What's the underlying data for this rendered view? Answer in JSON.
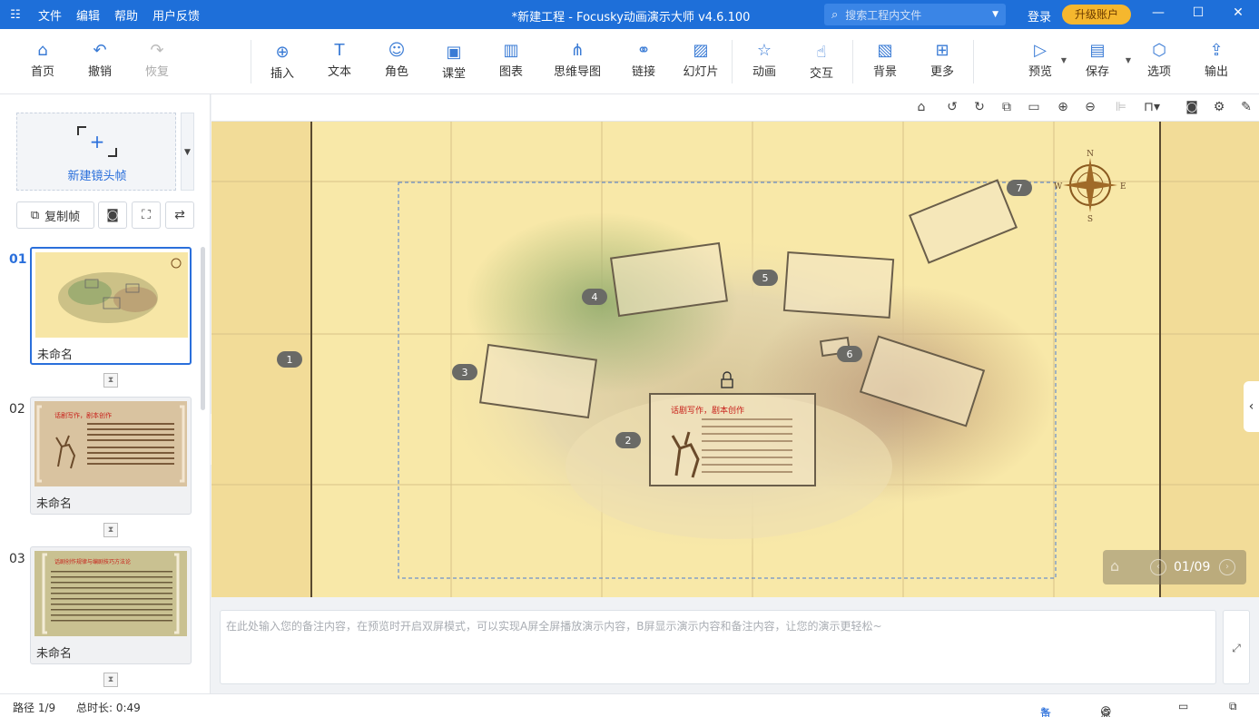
{
  "titlebar": {
    "logo": "☷",
    "menu": [
      "文件",
      "编辑",
      "帮助",
      "用户反馈"
    ],
    "title": "*新建工程 - Focusky动画演示大师  v4.6.100",
    "search_placeholder": "搜索工程内文件",
    "login": "登录",
    "upgrade": "升级账户",
    "accent": "#1e6fd9"
  },
  "toolbar": {
    "home": "首页",
    "undo": "撤销",
    "redo": "恢复",
    "insert": "插入",
    "text": "文本",
    "role": "角色",
    "classroom": "课堂",
    "chart": "图表",
    "mindmap": "思维导图",
    "link": "链接",
    "slide": "幻灯片",
    "animation": "动画",
    "interact": "交互",
    "background": "背景",
    "more": "更多",
    "preview": "预览",
    "save": "保存",
    "options": "选项",
    "export": "输出"
  },
  "left": {
    "new_frame": "新建镜头帧",
    "copy_frame": "复制帧",
    "frames": [
      {
        "num": "01",
        "name": "未命名"
      },
      {
        "num": "02",
        "name": "未命名"
      },
      {
        "num": "03",
        "name": "未命名"
      }
    ]
  },
  "canvas": {
    "markers": [
      "1",
      "2",
      "3",
      "4",
      "5",
      "6",
      "7"
    ],
    "compass": {
      "n": "N",
      "s": "S",
      "e": "E",
      "w": "W"
    },
    "slide_title_2": "话剧写作，剧本创作",
    "slide_title_3": "话剧创作规律与编剧技巧方法论"
  },
  "nav": {
    "counter": "01/09"
  },
  "notes": {
    "placeholder": "在此处输入您的备注内容，在预览时开启双屏模式，可以实现A屏全屏播放演示内容，B屏显示演示内容和备注内容，让您的演示更轻松~"
  },
  "status": {
    "path": "路径 1/9",
    "duration": "总时长: 0:49",
    "notes": "备注",
    "rollcall": "点名"
  }
}
